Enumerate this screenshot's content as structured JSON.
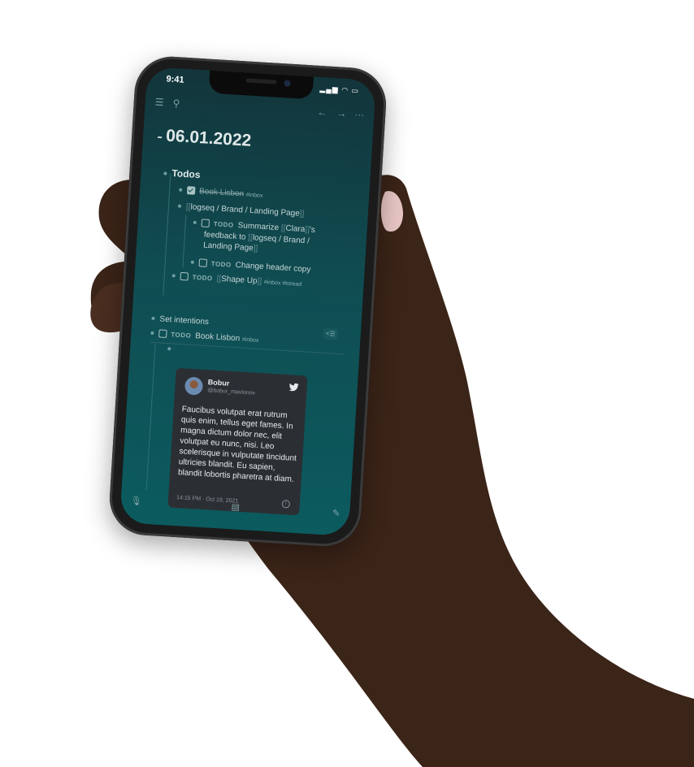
{
  "status": {
    "time": "9:41",
    "icons": "▂▄▆ ◠ ▭"
  },
  "toolbar": {
    "menu_icon": "menu-icon",
    "search_icon": "search-icon",
    "back_icon": "arrow-left-icon",
    "forward_icon": "arrow-right-icon",
    "more_icon": "more-icon"
  },
  "page": {
    "title": "06.01.2022"
  },
  "blocks": {
    "todos_label": "Todos",
    "book_lisbon_done": "Book Lisbon",
    "book_lisbon_tag": "#inbox",
    "landing_page_link": "logseq / Brand / Landing Page",
    "summarize_todo": "TODO",
    "summarize_text_1": "Summarize",
    "summarize_clara": "Clara",
    "summarize_text_2": "'s",
    "summarize_text_3": "feedback to",
    "summarize_link_1": "logseq / Brand /",
    "summarize_link_2": "Landing Page",
    "header_todo": "TODO",
    "header_text": "Change header copy",
    "shapeup_todo": "TODO",
    "shapeup_link": "Shape Up",
    "shapeup_tags": "#inbox #toread",
    "set_intentions": "Set intentions",
    "book2_todo": "TODO",
    "book2_text": "Book Lisbon",
    "book2_tag": "#inbox",
    "outdent_label": "<☰"
  },
  "tweet": {
    "name": "Bobur",
    "handle": "@bobur_mavlonov",
    "text": "Faucibus volutpat erat rutrum quis enim, tellus eget fames. In magna dictum dolor nec, elit volutpat eu nunc, nisi. Leo scelerisque in vulputate tincidunt ultricies blandit. Eu sapien, blandit lobortis pharetra at diam.",
    "time": "14:15 PM · Oct 19, 2021",
    "bird_icon": "twitter-bird-icon",
    "info_icon": "info-icon"
  },
  "bottombar": {
    "mic_icon": "microphone-icon",
    "doc_icon": "document-icon",
    "edit_icon": "edit-icon"
  },
  "colors": {
    "bg_top": "#12353b",
    "bg_bottom": "#0b5b5f",
    "tweet_bg": "#2b2f33"
  }
}
